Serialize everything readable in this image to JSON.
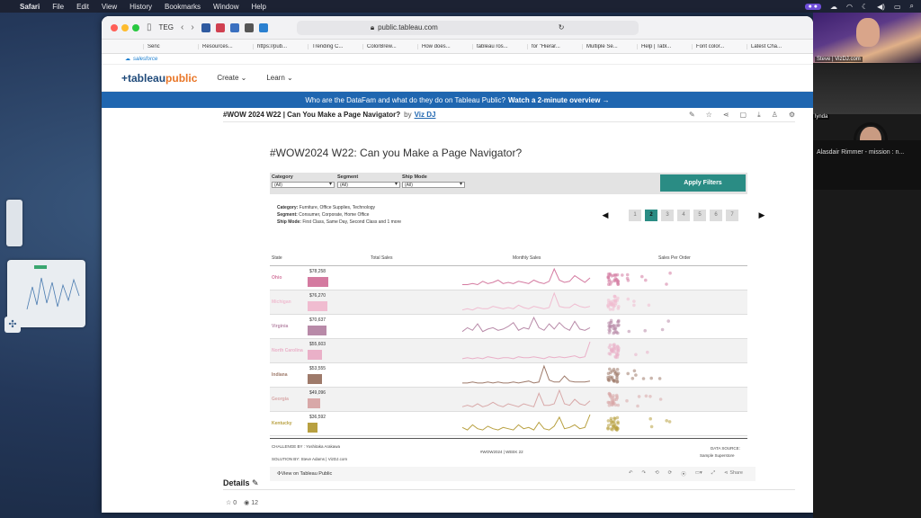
{
  "menubar": {
    "app": "Safari",
    "items": [
      "File",
      "Edit",
      "View",
      "History",
      "Bookmarks",
      "Window",
      "Help"
    ]
  },
  "browser": {
    "profile": "TEG",
    "url": "public.tableau.com",
    "favorites": [
      "Senc",
      "Resources...",
      "https://pub...",
      "Trending C...",
      "ColorBrew...",
      "How does...",
      "tableau ros...",
      "for \"Hierar...",
      "Multiple Se...",
      "Help | Tabl...",
      "Font color...",
      "Latest Cha..."
    ],
    "salesforce": "salesforce"
  },
  "tableau_public": {
    "logo_main": "+tableau",
    "logo_accent": "public",
    "nav": [
      "Create",
      "Learn"
    ],
    "banner_text": "Who are the DataFam and what do they do on Tableau Public?",
    "banner_link": "Watch a 2-minute overview →",
    "viz_title": "#WOW 2024 W22 | Can You Make a Page Navigator?",
    "by": "by",
    "author": "Viz DJ"
  },
  "viz": {
    "title": "#WOW2024 W22: Can you Make a Page Navigator?",
    "filters": [
      {
        "label": "Category",
        "value": "(All)"
      },
      {
        "label": "Segment",
        "value": "(All)"
      },
      {
        "label": "Ship Mode",
        "value": "(All)"
      }
    ],
    "apply_label": "Apply Filters",
    "summary": {
      "category_label": "Category:",
      "category_value": "Furniture, Office Supplies, Technology",
      "segment_label": "Segment:",
      "segment_value": "Consumer, Corporate, Home Office",
      "ship_label": "Ship Mode:",
      "ship_value": "First Class, Same Day, Second Class and 1 more"
    },
    "pager": {
      "prev": "◀",
      "next": "▶",
      "pages": [
        "1",
        "2",
        "3",
        "4",
        "5",
        "6",
        "7"
      ],
      "active_page": "2"
    },
    "columns": {
      "state": "State",
      "total": "Total Sales",
      "monthly": "Monthly Sales",
      "per_order": "Sales Per Order"
    },
    "rows": [
      {
        "state": "Ohio",
        "sales": "$78,258",
        "value": 78258,
        "color": "#d47aa0",
        "spark": [
          2,
          2,
          3,
          2,
          5,
          3,
          4,
          6,
          3,
          4,
          3,
          5,
          4,
          3,
          6,
          4,
          3,
          5,
          16,
          6,
          4,
          5,
          10,
          7,
          4,
          8
        ]
      },
      {
        "state": "Michigan",
        "sales": "$76,270",
        "value": 76270,
        "color": "#f0bcd0",
        "spark": [
          1,
          2,
          1,
          3,
          2,
          2,
          4,
          3,
          2,
          3,
          2,
          5,
          3,
          2,
          4,
          3,
          2,
          3,
          15,
          4,
          3,
          3,
          6,
          4,
          3,
          4
        ]
      },
      {
        "state": "Virginia",
        "sales": "$70,637",
        "value": 70637,
        "color": "#b88aa8",
        "spark": [
          3,
          6,
          4,
          9,
          3,
          5,
          6,
          4,
          5,
          7,
          10,
          4,
          6,
          5,
          14,
          6,
          4,
          9,
          5,
          10,
          6,
          4,
          11,
          5,
          4,
          6
        ]
      },
      {
        "state": "North Carolina",
        "sales": "$55,603",
        "value": 55603,
        "color": "#eab0c8",
        "spark": [
          1,
          2,
          1,
          2,
          1,
          3,
          2,
          1,
          2,
          2,
          1,
          3,
          2,
          2,
          3,
          2,
          1,
          3,
          2,
          3,
          2,
          3,
          4,
          2,
          3,
          18
        ]
      },
      {
        "state": "Indiana",
        "sales": "$53,555",
        "value": 53555,
        "color": "#9e7a6a",
        "spark": [
          1,
          1,
          2,
          1,
          1,
          2,
          1,
          2,
          1,
          1,
          2,
          1,
          2,
          3,
          1,
          2,
          18,
          4,
          2,
          2,
          8,
          3,
          2,
          2,
          2,
          3
        ]
      },
      {
        "state": "Georgia",
        "sales": "$49,096",
        "value": 49096,
        "color": "#d8a8a8",
        "spark": [
          1,
          2,
          1,
          3,
          1,
          2,
          4,
          2,
          1,
          3,
          2,
          1,
          3,
          2,
          1,
          10,
          2,
          2,
          3,
          12,
          3,
          2,
          6,
          3,
          2,
          5
        ]
      },
      {
        "state": "Kentucky",
        "sales": "$36,592",
        "value": 36592,
        "color": "#b8a040",
        "spark": [
          4,
          2,
          6,
          3,
          2,
          5,
          3,
          2,
          4,
          3,
          2,
          6,
          3,
          4,
          2,
          8,
          3,
          2,
          5,
          12,
          3,
          4,
          6,
          3,
          4,
          14
        ]
      }
    ],
    "footer": {
      "challenge": "CHALLENGE BY : Yoshitaka Arakawa",
      "solution": "SOLUTION BY: Steve Adams | VizDJ.com",
      "center": "#WOW2024 | WEEK 22",
      "source_title": "DATA SOURCE:",
      "source_value": "Sample Superstore"
    },
    "toolbar": {
      "view_on": "View on Tableau Public",
      "share": "Share"
    }
  },
  "details": {
    "title": "Details",
    "likes": "0",
    "views": "12"
  },
  "participants": [
    {
      "name": "Steve | VizDJ.com"
    },
    {
      "name": "lynda"
    },
    {
      "name": "Alasdair Rimmer - mission : n..."
    }
  ],
  "colors": {
    "accent": "#2a8c84",
    "banner": "#1f66b0",
    "tableau_blue": "#1f4a7a",
    "tableau_orange": "#e97627"
  }
}
